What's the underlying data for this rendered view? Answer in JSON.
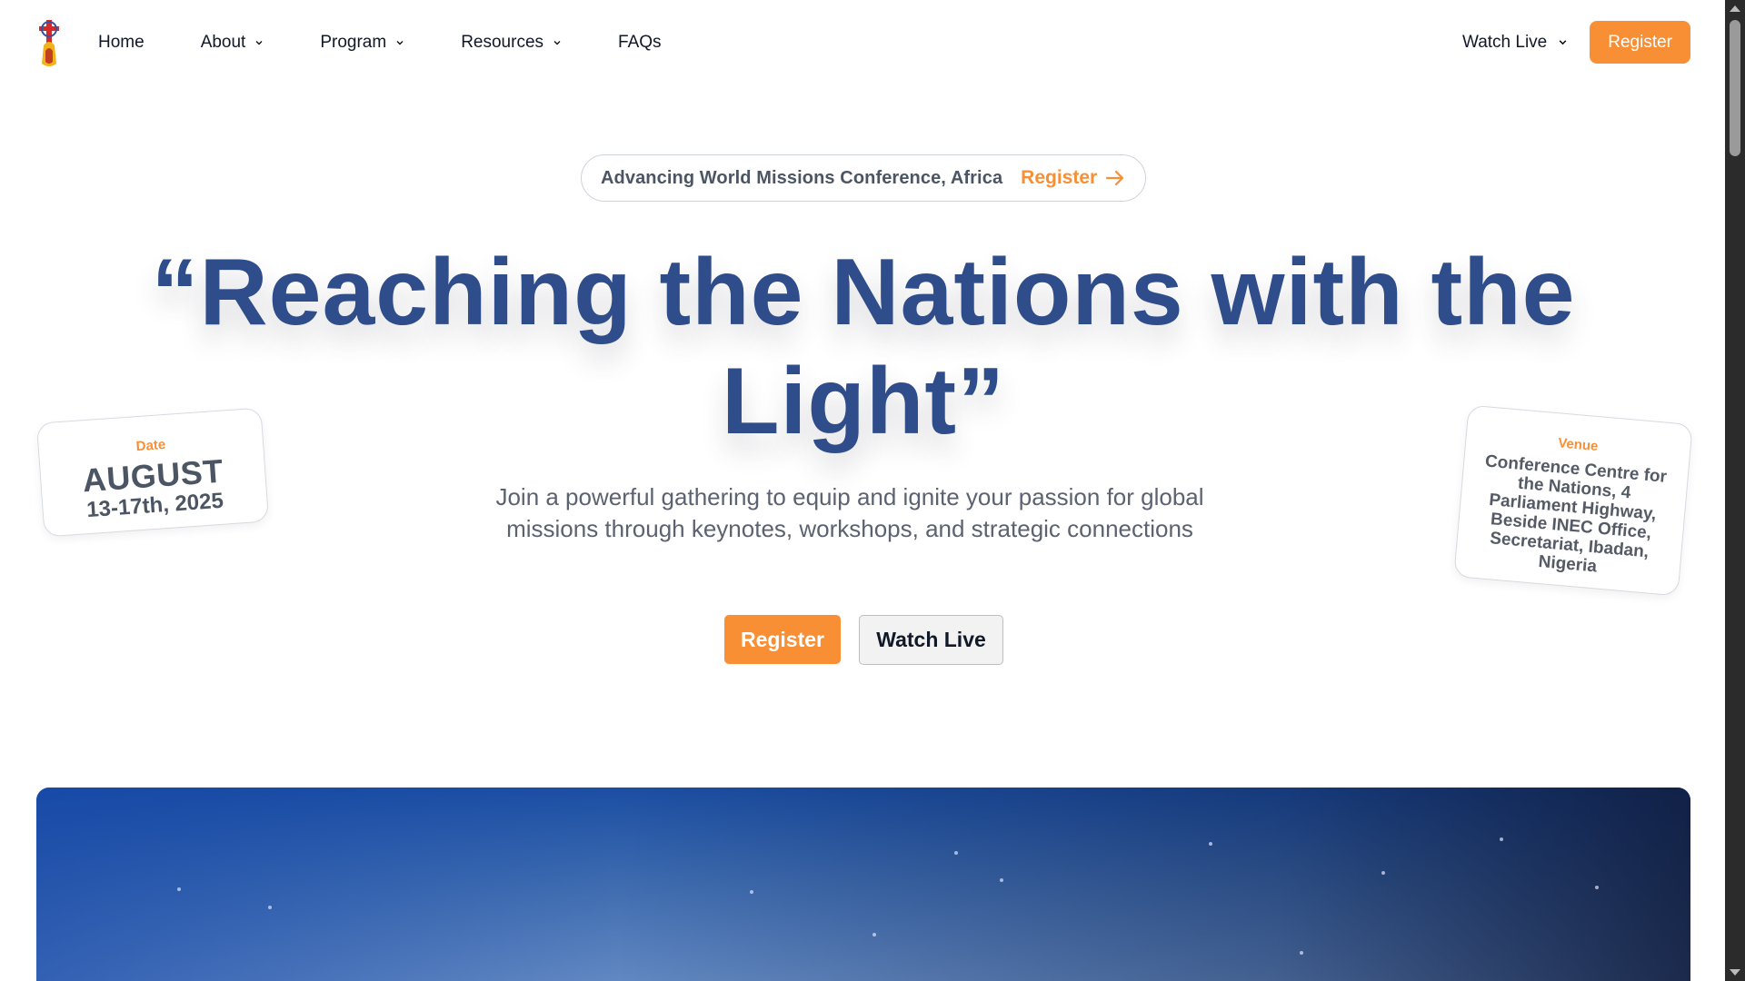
{
  "nav": {
    "logo_icon": "mission-logo-icon",
    "items": [
      {
        "label": "Home",
        "has_dropdown": false
      },
      {
        "label": "About",
        "has_dropdown": true
      },
      {
        "label": "Program",
        "has_dropdown": true
      },
      {
        "label": "Resources",
        "has_dropdown": true
      },
      {
        "label": "FAQs",
        "has_dropdown": false
      }
    ],
    "watch_live_label": "Watch Live",
    "register_label": "Register"
  },
  "announcement": {
    "text": "Advancing World Missions Conference, Africa",
    "link_label": "Register",
    "link_icon": "arrow-right-icon"
  },
  "hero": {
    "headline": "“Reaching the Nations with the Light”",
    "subtitle": "Join a powerful gathering to equip and ignite your passion for global missions through keynotes, workshops, and strategic connections",
    "register_label": "Register",
    "watch_live_label": "Watch Live"
  },
  "date_card": {
    "label": "Date",
    "month": "AUGUST",
    "days": "13-17th, 2025"
  },
  "venue_card": {
    "label": "Venue",
    "text": "Conference Centre for the Nations, 4 Parliament Highway, Beside INEC Office, Secretariat, Ibadan, Nigeria"
  },
  "colors": {
    "accent": "#f98f35",
    "headline": "#2f4d8a",
    "body_text": "#5b6270"
  }
}
